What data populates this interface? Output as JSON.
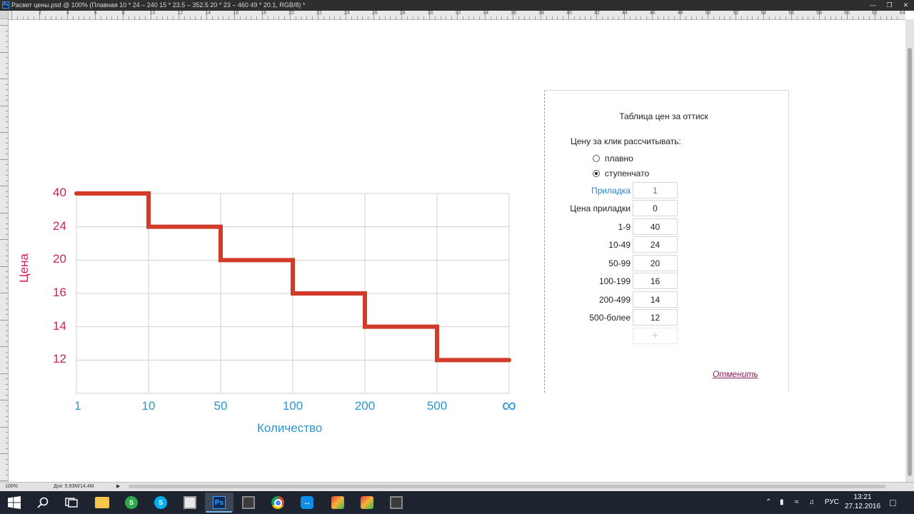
{
  "window": {
    "app_icon": "Ps",
    "title": "Расвет цены.psd @ 100% (Плавная 10 * 24 – 240 15 * 23.5 – 352.5 20 * 23 – 460 49 * 20.1, RGB/8) *"
  },
  "ruler_numbers": [
    "2",
    "4",
    "6",
    "8",
    "10",
    "12",
    "14",
    "16",
    "18",
    "20",
    "22",
    "24",
    "26",
    "28",
    "30",
    "32",
    "34",
    "36",
    "38",
    "40",
    "42",
    "44",
    "46",
    "48",
    "50",
    "52",
    "54",
    "56",
    "58",
    "60",
    "62",
    "64",
    "66"
  ],
  "status": {
    "zoom": "100%",
    "doc": "Док: 5,93M/14,4M"
  },
  "chart_data": {
    "type": "line",
    "step": true,
    "categories": [
      "1",
      "10",
      "50",
      "100",
      "200",
      "500",
      "∞"
    ],
    "y_ticks": [
      "40",
      "24",
      "20",
      "16",
      "14",
      "12"
    ],
    "points": [
      [
        1,
        40
      ],
      [
        10,
        40
      ],
      [
        10,
        24
      ],
      [
        50,
        24
      ],
      [
        50,
        20
      ],
      [
        100,
        20
      ],
      [
        100,
        16
      ],
      [
        200,
        16
      ],
      [
        200,
        14
      ],
      [
        500,
        14
      ],
      [
        500,
        12
      ],
      [
        12,
        "∞"
      ]
    ],
    "steps": [
      {
        "from": "1",
        "to": "10",
        "value": 40
      },
      {
        "from": "10",
        "to": "50",
        "value": 24
      },
      {
        "from": "50",
        "to": "100",
        "value": 20
      },
      {
        "from": "100",
        "to": "200",
        "value": 16
      },
      {
        "from": "200",
        "to": "500",
        "value": 14
      },
      {
        "from": "500",
        "to": "∞",
        "value": 12
      }
    ],
    "xlabel": "Количество",
    "ylabel": "Цена",
    "line_color": "#d23a2a",
    "ylabel_color": "#cc1f5c",
    "xlabel_color": "#2a96cf",
    "grid": true
  },
  "panel": {
    "title": "Таблица цен за оттиск",
    "calc_label": "Цену за клик рассчитывать:",
    "options": [
      {
        "label": "плавно",
        "selected": false
      },
      {
        "label": "ступенчато",
        "selected": true
      }
    ],
    "rows": [
      {
        "label": "Приладка",
        "value": "1",
        "highlight": true
      },
      {
        "label": "Цена приладки",
        "value": "0",
        "highlight": false
      },
      {
        "label": "1-9",
        "value": "40",
        "highlight": false
      },
      {
        "label": "10-49",
        "value": "24",
        "highlight": false
      },
      {
        "label": "50-99",
        "value": "20",
        "highlight": false
      },
      {
        "label": "100-199",
        "value": "16",
        "highlight": false
      },
      {
        "label": "200-499",
        "value": "14",
        "highlight": false
      },
      {
        "label": "500-более",
        "value": "12",
        "highlight": false
      }
    ],
    "add_label": "+",
    "cancel_label": "Отменить"
  },
  "taskbar": {
    "apps": [
      {
        "name": "windows-start",
        "icon": "windows-logo-icon"
      },
      {
        "name": "search",
        "icon": "search-icon"
      },
      {
        "name": "task-view",
        "icon": "task-view-icon"
      },
      {
        "name": "file-explorer",
        "icon": "folder-icon"
      },
      {
        "name": "app-s-green",
        "icon": "s-green-icon"
      },
      {
        "name": "skype",
        "icon": "skype-icon"
      },
      {
        "name": "calculator",
        "icon": "calculator-icon"
      },
      {
        "name": "photoshop",
        "icon": "photoshop-icon",
        "label": "Ps"
      },
      {
        "name": "media-app",
        "icon": "media-icon"
      },
      {
        "name": "chrome",
        "icon": "chrome-icon"
      },
      {
        "name": "teamviewer",
        "icon": "teamviewer-icon"
      },
      {
        "name": "app-colorful-1",
        "icon": "colorful-app-icon"
      },
      {
        "name": "app-colorful-2",
        "icon": "colorful-app-icon"
      },
      {
        "name": "media-app-2",
        "icon": "media-icon"
      }
    ],
    "language": "РУС",
    "time": "13:21",
    "date": "27.12.2016"
  }
}
